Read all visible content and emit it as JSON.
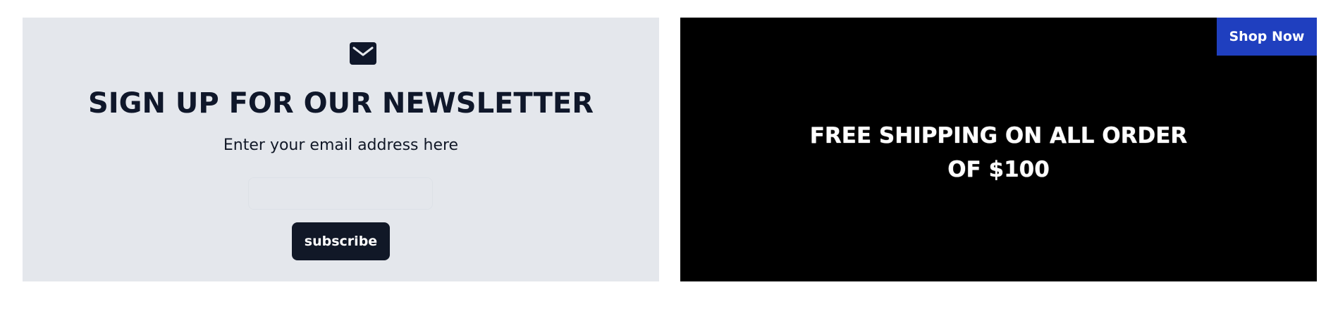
{
  "newsletter": {
    "icon": "mail-icon",
    "title": "SIGN UP FOR OUR NEWSLETTER",
    "subtitle": "Enter your email address here",
    "email_value": "",
    "email_placeholder": "",
    "subscribe_label": "subscribe",
    "background": "#e4e7ec",
    "text_color": "#0f172a"
  },
  "promo": {
    "line1": "FREE SHIPPING ON ALL ORDER",
    "line2": "OF $100",
    "shop_label": "Shop Now",
    "background": "#000000",
    "shop_button_color": "#1f3fbf"
  }
}
